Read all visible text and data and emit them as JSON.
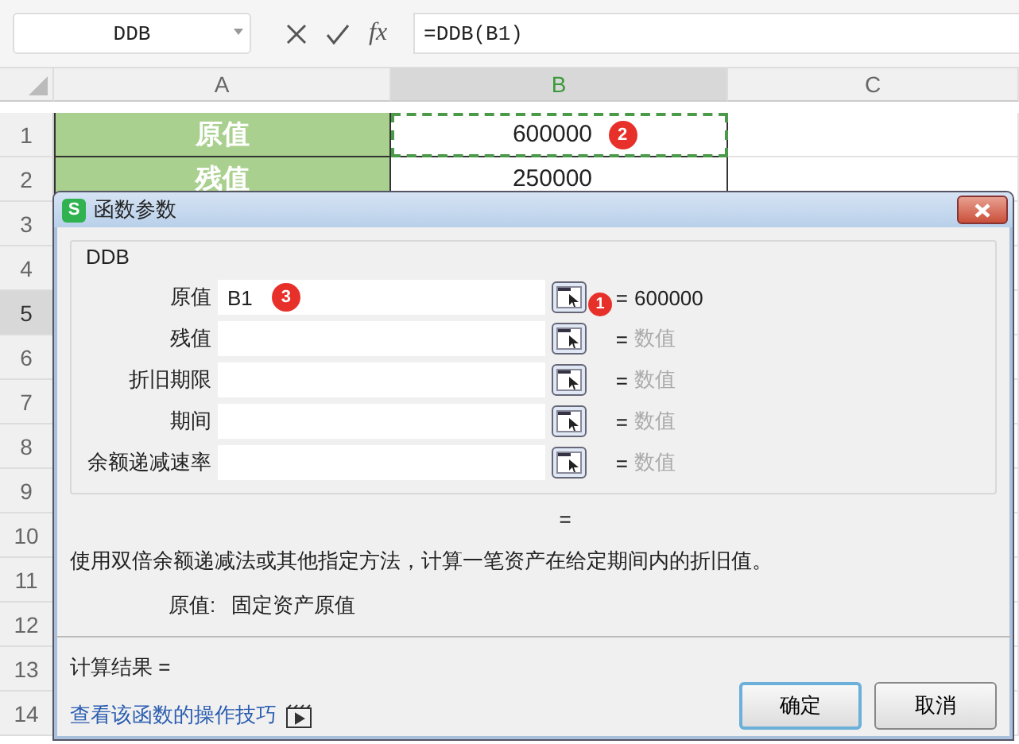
{
  "name_box": {
    "value": "DDB"
  },
  "formula_bar": {
    "fx": "fx",
    "value": "=DDB(B1)"
  },
  "columns": [
    {
      "label": "A",
      "selected": false
    },
    {
      "label": "B",
      "selected": true
    },
    {
      "label": "C",
      "selected": false
    }
  ],
  "row_headers": [
    {
      "label": "1",
      "selected": false
    },
    {
      "label": "2",
      "selected": false
    },
    {
      "label": "3",
      "selected": false
    },
    {
      "label": "4",
      "selected": false
    },
    {
      "label": "5",
      "selected": true
    },
    {
      "label": "6",
      "selected": false
    },
    {
      "label": "7",
      "selected": false
    },
    {
      "label": "8",
      "selected": false
    },
    {
      "label": "9",
      "selected": false
    },
    {
      "label": "10",
      "selected": false
    },
    {
      "label": "11",
      "selected": false
    },
    {
      "label": "12",
      "selected": false
    },
    {
      "label": "13",
      "selected": false
    },
    {
      "label": "14",
      "selected": false
    }
  ],
  "rows": [
    {
      "a": "原值",
      "b": "600000",
      "copy_marquee": true,
      "badge": "2"
    },
    {
      "a": "残值",
      "b": "250000",
      "copy_marquee": false
    }
  ],
  "dialog": {
    "icon_text": "S",
    "title": "函数参数",
    "group": "DDB",
    "params": [
      {
        "label": "原值",
        "value": "B1",
        "badge": "3",
        "button_badge": "1",
        "equals": "=",
        "result": "600000",
        "kind": "value"
      },
      {
        "label": "残值",
        "equals": "=",
        "result": "数值",
        "kind": "hint"
      },
      {
        "label": "折旧期限",
        "equals": "=",
        "result": "数值",
        "kind": "hint"
      },
      {
        "label": "期间",
        "equals": "=",
        "result": "数值",
        "kind": "hint"
      },
      {
        "label": "余额递减速率",
        "equals": "=",
        "result": "数值",
        "kind": "hint"
      }
    ],
    "summary_equals": "=",
    "description": "使用双倍余额递减法或其他指定方法，计算一笔资产在给定期间内的折旧值。",
    "arg_help": {
      "label": "原值:",
      "text": "固定资产原值"
    },
    "result_label": "计算结果 =",
    "help_link": "查看该函数的操作技巧",
    "buttons": [
      {
        "label": "确定",
        "default": true
      },
      {
        "label": "取消",
        "default": false
      }
    ]
  }
}
